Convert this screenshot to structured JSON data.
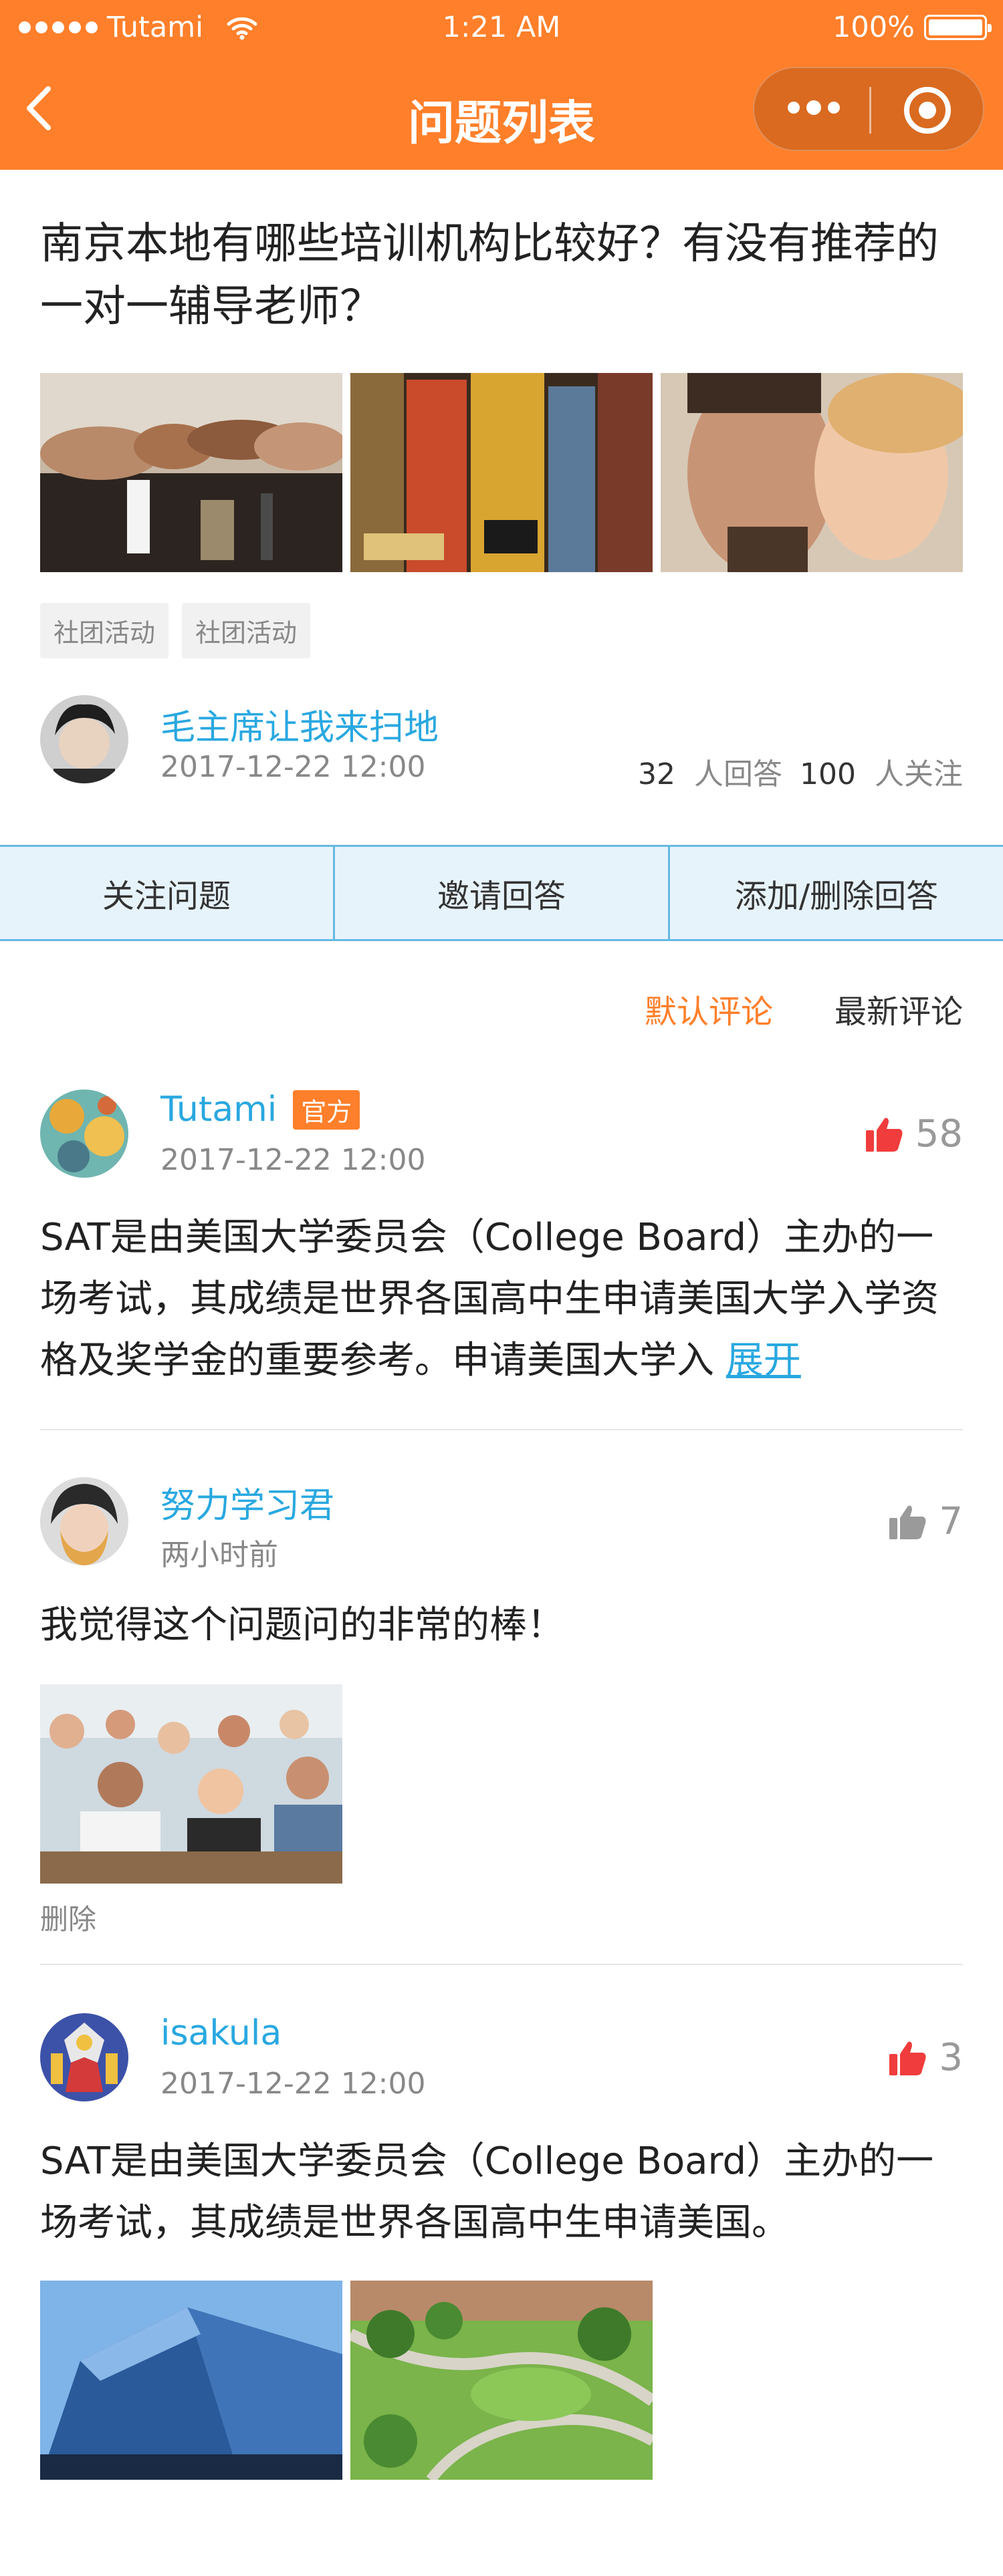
{
  "status_bar": {
    "carrier": "Tutami",
    "time": "1:21 AM",
    "battery": "100%"
  },
  "nav": {
    "title": "问题列表"
  },
  "question": {
    "title": "南京本地有哪些培训机构比较好？有没有推荐的一对一辅导老师？",
    "tags": [
      "社团活动",
      "社团活动"
    ],
    "author": {
      "name": "毛主席让我来扫地",
      "date": "2017-12-22 12:00"
    },
    "answers_count": "32",
    "answers_label": "人回答",
    "followers_count": "100",
    "followers_label": "人关注"
  },
  "actions": [
    "关注问题",
    "邀请回答",
    "添加/删除回答"
  ],
  "sort": {
    "default": "默认评论",
    "latest": "最新评论"
  },
  "comments": [
    {
      "name": "Tutami",
      "badge": "官方",
      "date": "2017-12-22 12:00",
      "likes": "58",
      "liked": true,
      "text": "SAT是由美国大学委员会（College Board）主办的一场考试，其成绩是世界各国高中生申请美国大学入学资格及奖学金的重要参考。申请美国大学入",
      "expand": "展开"
    },
    {
      "name": "努力学习君",
      "date": "两小时前",
      "likes": "7",
      "liked": false,
      "text": "我觉得这个问题问的非常的棒！",
      "delete": "删除"
    },
    {
      "name": "isakula",
      "date": "2017-12-22 12:00",
      "likes": "3",
      "liked": true,
      "text": "SAT是由美国大学委员会（College Board）主办的一场考试，其成绩是世界各国高中生申请美国。"
    }
  ],
  "colors": {
    "accent": "#ff7f2a",
    "link": "#29a8e0",
    "like_active": "#f03c3c",
    "like_inactive": "#9a9a9a"
  }
}
